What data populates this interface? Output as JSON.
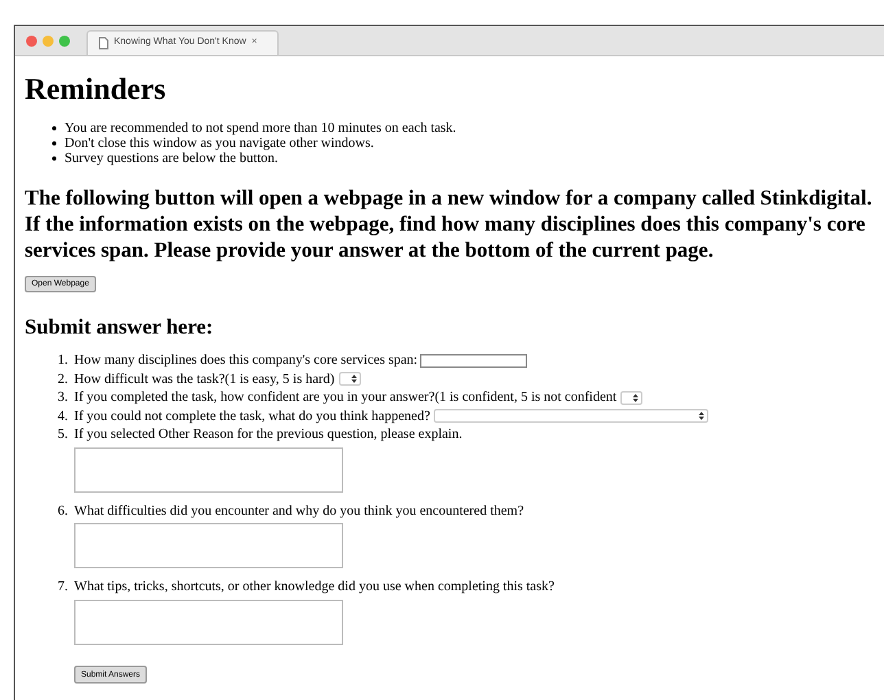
{
  "browser": {
    "tab_title": "Knowing What You Don't Know",
    "tab_close": "×"
  },
  "reminders": {
    "heading": "Reminders",
    "items": [
      "You are recommended to not spend more than 10 minutes on each task.",
      "Don't close this window as you navigate other windows.",
      "Survey questions are below the button."
    ]
  },
  "instructions": "The following button will open a webpage in a new window for a company called Stinkdigital. If the information exists on the webpage, find how many disciplines does this company's core services span. Please provide your answer at the bottom of the current page.",
  "open_button": "Open Webpage",
  "submit_heading": "Submit answer here:",
  "questions": [
    {
      "number": "1.",
      "label": "How many disciplines does this company's core services span:",
      "kind": "text"
    },
    {
      "number": "2.",
      "label": "How difficult was the task?(1 is easy, 5 is hard)",
      "kind": "select"
    },
    {
      "number": "3.",
      "label": "If you completed the task, how confident are you in your answer?(1 is confident, 5 is not confident",
      "kind": "select"
    },
    {
      "number": "4.",
      "label": "If you could not complete the task, what do you think happened?",
      "kind": "wide-select"
    },
    {
      "number": "5.",
      "label": "If you selected Other Reason for the previous question, please explain.",
      "kind": "textarea"
    },
    {
      "number": "6.",
      "label": "What difficulties did you encounter and why do you think you encountered them?",
      "kind": "textarea"
    },
    {
      "number": "7.",
      "label": "What tips, tricks, shortcuts, or other knowledge did you use when completing this task?",
      "kind": "textarea"
    }
  ],
  "submit_button": "Submit Answers"
}
